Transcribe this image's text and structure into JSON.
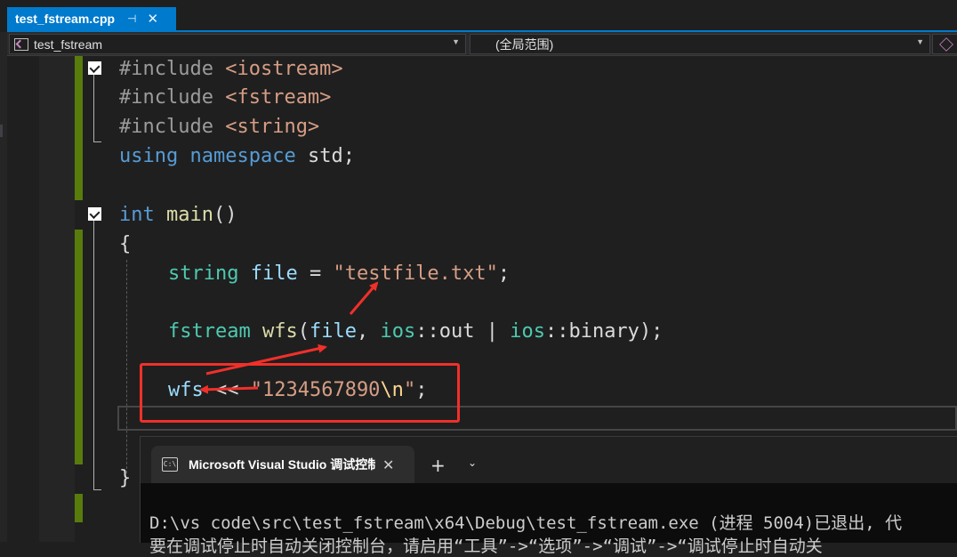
{
  "tab": {
    "title": "test_fstream.cpp",
    "pin_glyph": "⊣",
    "close_glyph": "✕",
    "accent": "#007acc"
  },
  "navbar": {
    "project": "test_fstream",
    "scope": "(全局范围)"
  },
  "code": {
    "line1": [
      "#include",
      "<iostream>"
    ],
    "line2": [
      "#include",
      "<fstream>"
    ],
    "line3": [
      "#include",
      "<string>"
    ],
    "line4": [
      "using",
      "namespace",
      "std;"
    ],
    "line5": [
      "int",
      "main",
      "()"
    ],
    "line6": [
      "{"
    ],
    "line7": [
      "string",
      "file",
      " = ",
      "\"testfile.txt\"",
      ";"
    ],
    "line8": [
      "fstream",
      "wfs",
      "(",
      "file",
      ", ",
      "ios",
      "::",
      "out",
      " | ",
      "ios",
      "::",
      "binary",
      ");"
    ],
    "line9": [
      "wfs",
      " << ",
      "\"1234567890",
      "\\n",
      "\"",
      ";"
    ],
    "line10": [
      "}"
    ]
  },
  "colors": {
    "keyword": "#569cd6",
    "type": "#4ec9b0",
    "function": "#dcdcaa",
    "string": "#d69d85",
    "variable": "#9cdcfe",
    "change_bar": "#587c0c",
    "annotation": "#f0302a"
  },
  "console": {
    "tab_title": "Microsoft Visual Studio 调试控制台",
    "new_tab_glyph": "+",
    "dropdown_glyph": "⌄",
    "close_glyph": "✕",
    "icon_text": "C:\\",
    "line1": "D:\\vs code\\src\\test_fstream\\x64\\Debug\\test_fstream.exe (进程 5004)已退出, 代",
    "line2": "要在调试停止时自动关闭控制台，请启用“工具”->“选项”->“调试”->“调试停止时自动关"
  }
}
